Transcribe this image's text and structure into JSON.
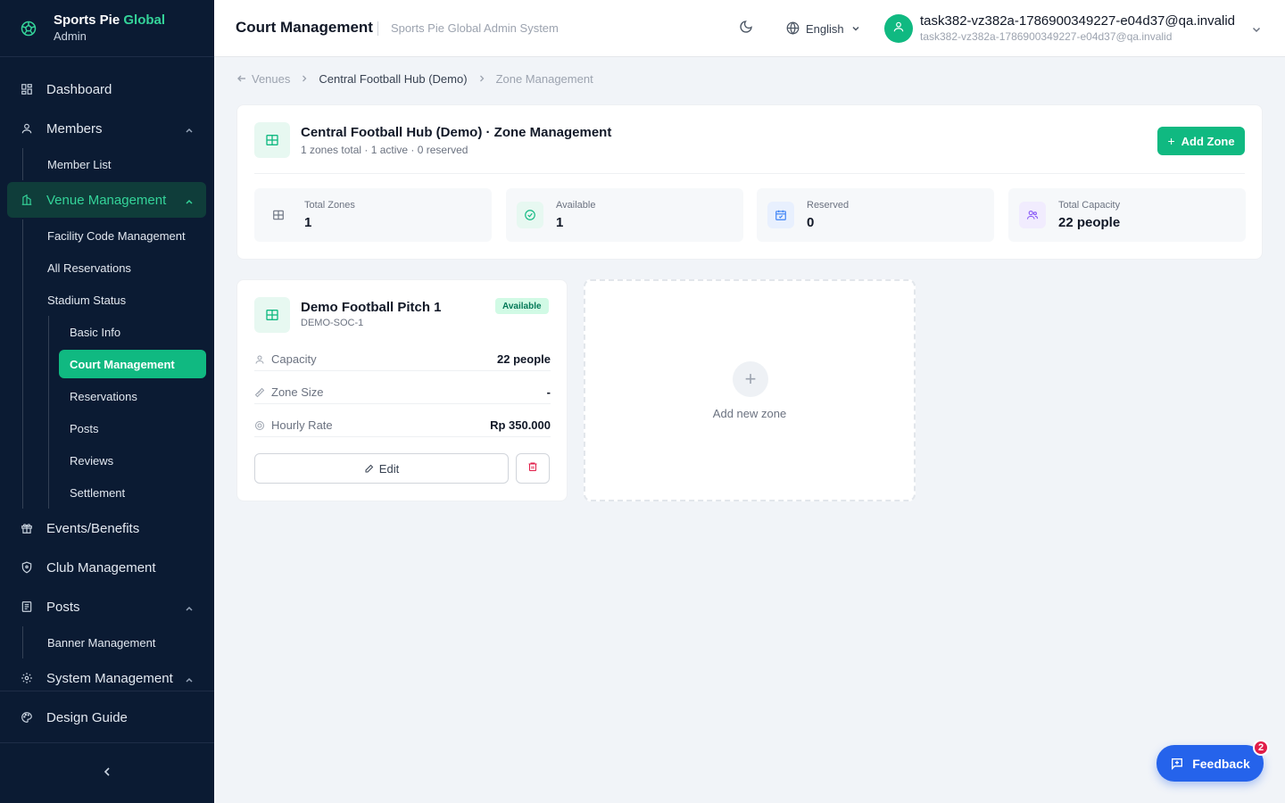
{
  "brand": {
    "name_main": "Sports Pie ",
    "name_accent": "Global",
    "role": "Admin"
  },
  "sidebar": {
    "dashboard": "Dashboard",
    "members": "Members",
    "member_list": "Member List",
    "venue_management": "Venue Management",
    "facility_code_management": "Facility Code Management",
    "all_reservations": "All Reservations",
    "stadium_status": "Stadium Status",
    "basic_info": "Basic Info",
    "court_management": "Court Management",
    "reservations": "Reservations",
    "posts_sub": "Posts",
    "reviews": "Reviews",
    "settlement": "Settlement",
    "events_benefits": "Events/Benefits",
    "club_management": "Club Management",
    "posts": "Posts",
    "banner_management": "Banner Management",
    "system_management": "System Management",
    "design_guide": "Design Guide"
  },
  "header": {
    "title": "Court Management",
    "subtitle": "Sports Pie Global Admin System",
    "language": "English",
    "user_name": "task382-vz382a-1786900349227-e04d37@qa.invalid",
    "user_email": "task382-vz382a-1786900349227-e04d37@qa.invalid"
  },
  "breadcrumb": {
    "venues": "Venues",
    "venue": "Central Football Hub (Demo)",
    "current": "Zone Management"
  },
  "summary": {
    "title": "Central Football Hub (Demo) · Zone Management",
    "subtitle": "1 zones total · 1 active · 0 reserved",
    "add_zone_label": "Add Zone",
    "stats": [
      {
        "label": "Total Zones",
        "value": "1",
        "icon": "grid-icon",
        "color": "#6b7280",
        "bg": "#eef1f5"
      },
      {
        "label": "Available",
        "value": "1",
        "icon": "check-circle-icon",
        "color": "#10b981",
        "bg": "#e7f8f1"
      },
      {
        "label": "Reserved",
        "value": "0",
        "icon": "calendar-icon",
        "color": "#3b82f6",
        "bg": "#e8f0fe"
      },
      {
        "label": "Total Capacity",
        "value": "22 people",
        "icon": "users-icon",
        "color": "#8b5cf6",
        "bg": "#f1ecfe"
      }
    ]
  },
  "zone": {
    "name": "Demo Football Pitch 1",
    "code": "DEMO-SOC-1",
    "status": "Available",
    "capacity_label": "Capacity",
    "capacity_value": "22 people",
    "size_label": "Zone Size",
    "size_value": "-",
    "rate_label": "Hourly Rate",
    "rate_value": "Rp 350.000",
    "edit_label": "Edit"
  },
  "add_new_zone": {
    "label": "Add new zone"
  },
  "feedback": {
    "label": "Feedback",
    "count": "2"
  },
  "colors": {
    "accent": "#10b981",
    "sidebar_bg": "#0b1b33",
    "feedback": "#2563eb",
    "danger": "#e11d48"
  }
}
